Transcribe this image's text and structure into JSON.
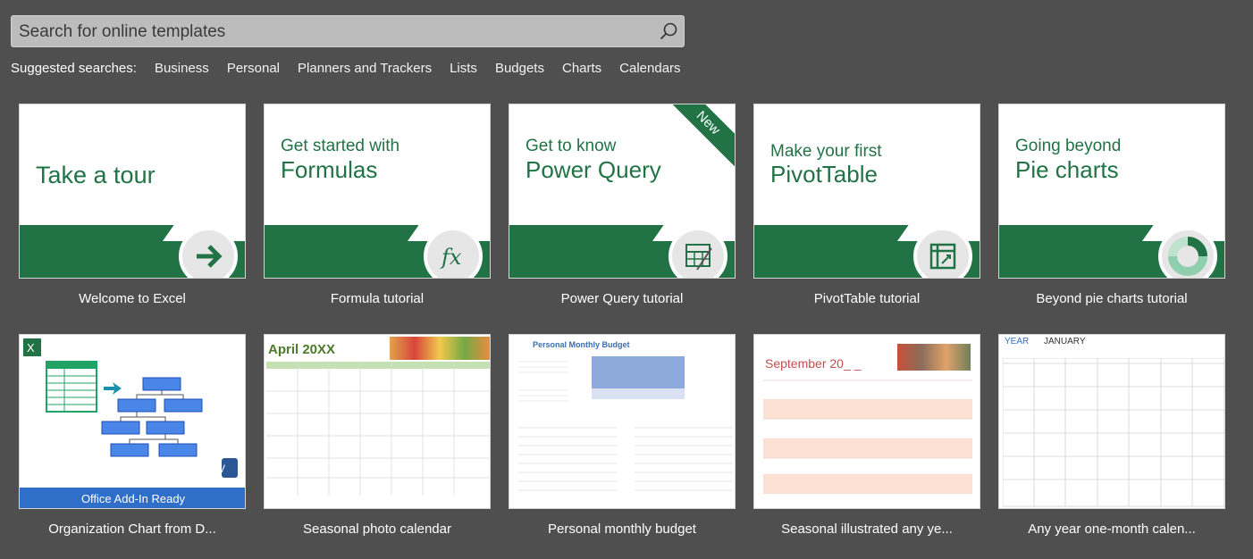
{
  "search": {
    "placeholder": "Search for online templates"
  },
  "suggested": {
    "label": "Suggested searches:",
    "links": [
      "Business",
      "Personal",
      "Planners and Trackers",
      "Lists",
      "Budgets",
      "Charts",
      "Calendars"
    ]
  },
  "templates": [
    {
      "caption": "Welcome to Excel",
      "line1": "",
      "line2": "Take a tour"
    },
    {
      "caption": "Formula tutorial",
      "line1": "Get started with",
      "line2": "Formulas"
    },
    {
      "caption": "Power Query tutorial",
      "line1": "Get to know",
      "line2": "Power Query",
      "badge": "New"
    },
    {
      "caption": "PivotTable tutorial",
      "line1": "Make your first",
      "line2": "PivotTable"
    },
    {
      "caption": "Beyond pie charts tutorial",
      "line1": "Going beyond",
      "line2": "Pie charts"
    },
    {
      "caption": "Organization Chart from D...",
      "banner": "Office Add-In Ready"
    },
    {
      "caption": "Seasonal photo calendar",
      "title": "April 20XX"
    },
    {
      "caption": "Personal monthly budget",
      "title": "Personal Monthly Budget"
    },
    {
      "caption": "Seasonal illustrated any ye...",
      "title": "September 20_ _"
    },
    {
      "caption": "Any year one-month calen...",
      "year_label": "YEAR",
      "month_label": "JANUARY"
    }
  ],
  "colors": {
    "accent": "#217346",
    "background": "#4f4f4f"
  }
}
